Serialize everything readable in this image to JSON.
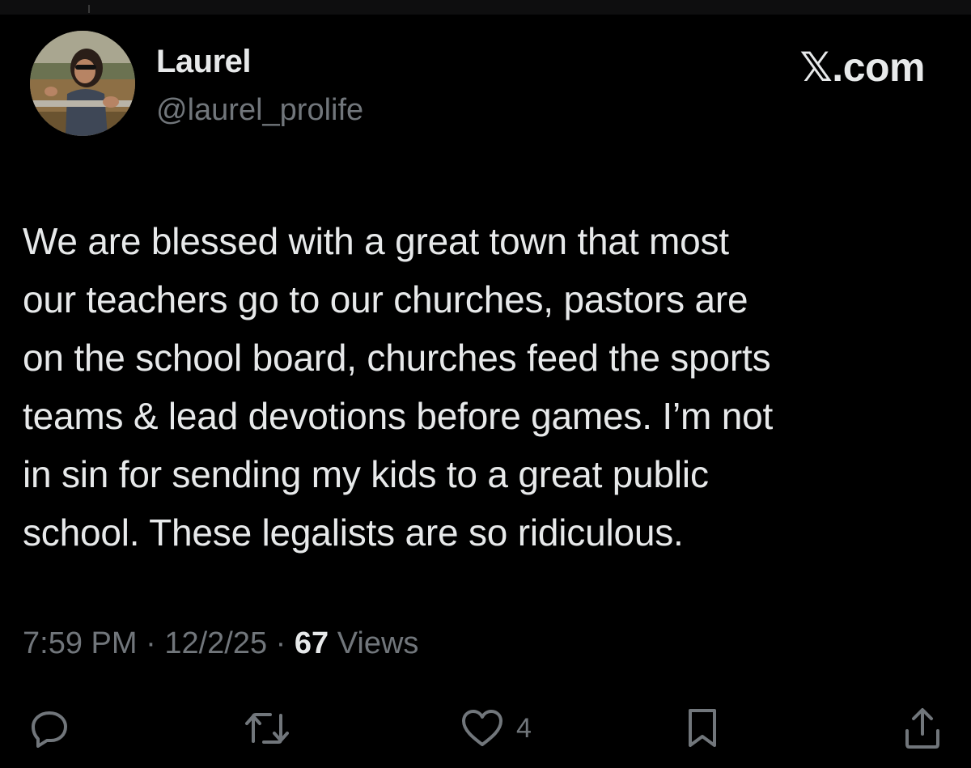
{
  "author": {
    "display_name": "Laurel",
    "handle": "@laurel_prolife"
  },
  "source": {
    "label": ".com",
    "logo_icon": "x-logo-icon"
  },
  "tweet": {
    "text": "We are blessed with a great town that most\nour teachers go to our churches, pastors are\non the school board, churches feed the sports\nteams & lead devotions before games. I’m not\nin sin for sending my kids to a great public\nschool. These legalists are so ridiculous."
  },
  "meta": {
    "time": "7:59 PM",
    "separator": " · ",
    "date": "12/2/25",
    "views_count": "67",
    "views_label": " Views"
  },
  "actions": {
    "reply_icon": "reply-icon",
    "repost_icon": "repost-icon",
    "like_icon": "heart-icon",
    "like_count": "4",
    "bookmark_icon": "bookmark-icon",
    "share_icon": "share-icon"
  },
  "colors": {
    "background": "#000000",
    "primary_text": "#e7e9ea",
    "secondary_text": "#71767b"
  }
}
